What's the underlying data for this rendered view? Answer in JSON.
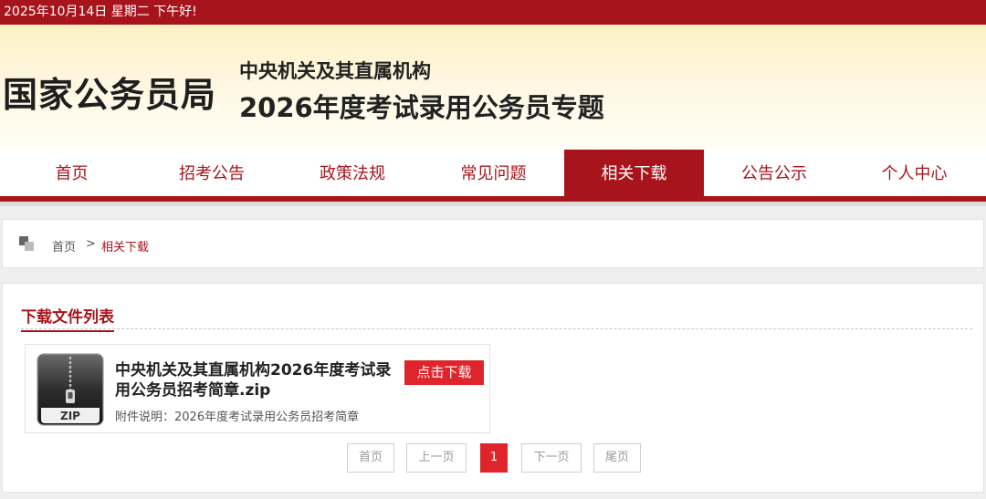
{
  "topbar": {
    "text": "2025年10月14日  星期二  下午好!"
  },
  "header": {
    "logo": "国家公务员局",
    "title_line1": "中央机关及其直属机构",
    "title_line2": "2026年度考试录用公务员专题"
  },
  "nav": {
    "items": [
      "首页",
      "招考公告",
      "政策法规",
      "常见问题",
      "相关下载",
      "公告公示",
      "个人中心"
    ],
    "active_index": 4
  },
  "breadcrumb": {
    "home": "首页",
    "separator": ">",
    "current": "相关下载"
  },
  "section": {
    "title": "下载文件列表"
  },
  "file": {
    "icon_label": "ZIP",
    "name": "中央机关及其直属机构2026年度考试录用公务员招考简章.zip",
    "description": "附件说明：2026年度考试录用公务员招考简章",
    "download_label": "点击下载"
  },
  "pagination": {
    "first": "首页",
    "prev": "上一页",
    "current": "1",
    "next": "下一页",
    "last": "尾页"
  },
  "colors": {
    "brand_red": "#a8141c",
    "button_red": "#e0242b"
  }
}
